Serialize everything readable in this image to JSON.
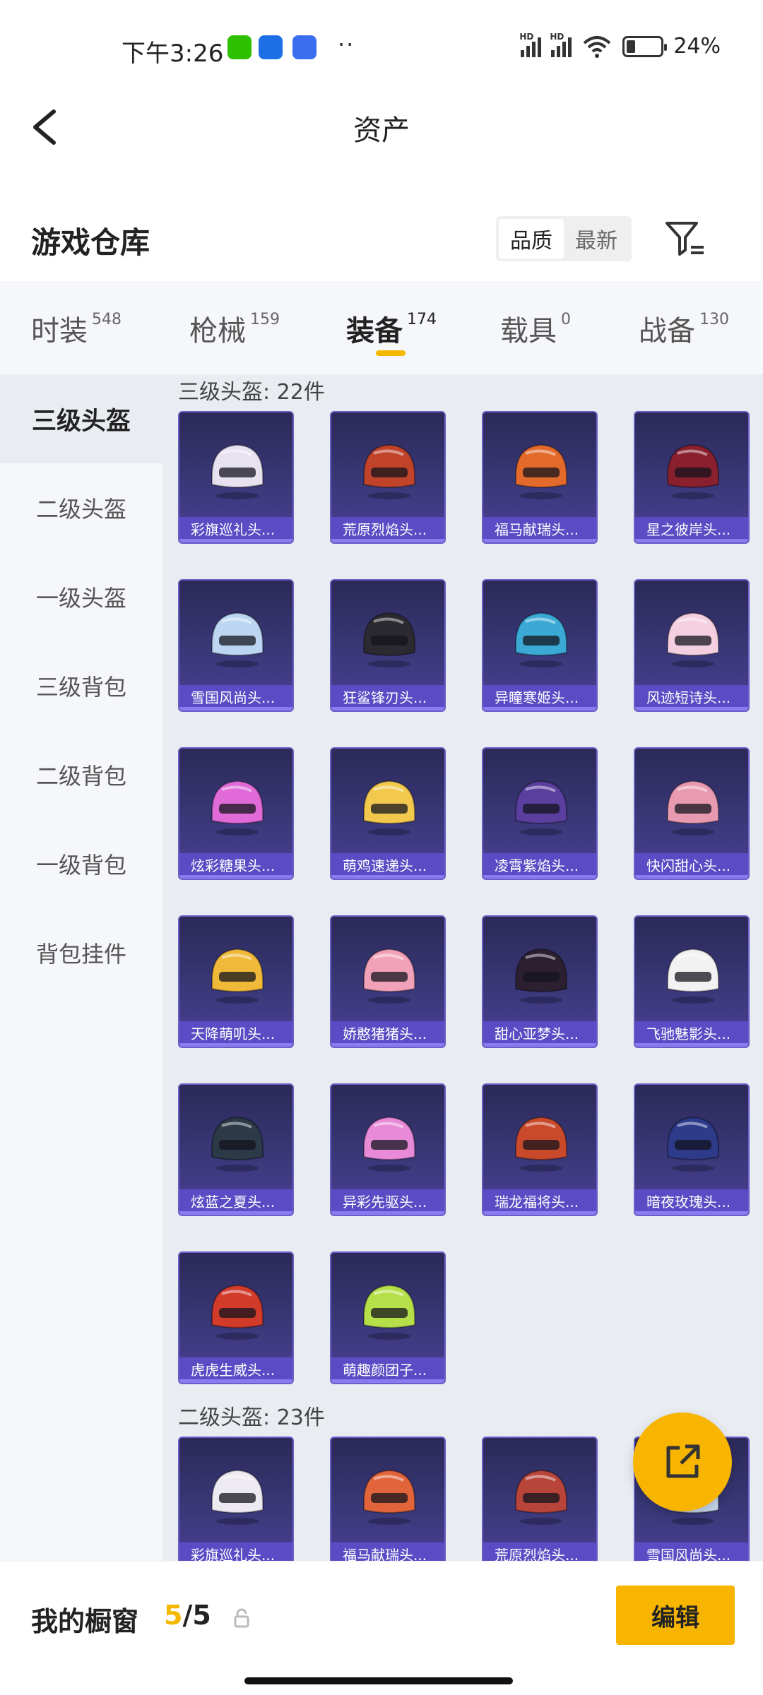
{
  "status": {
    "time": "下午3:26",
    "dots": "··",
    "hd": "HD",
    "battery_level": 0.24,
    "battery_text": "24%",
    "app_colors": [
      "#2dc100",
      "#1e6fe6",
      "#3a6df0"
    ]
  },
  "nav": {
    "title": "资产"
  },
  "warehouse": {
    "title": "游戏仓库",
    "sort_options": [
      "品质",
      "最新"
    ]
  },
  "tabs": [
    {
      "label": "时装",
      "count": "548"
    },
    {
      "label": "枪械",
      "count": "159"
    },
    {
      "label": "装备",
      "count": "174"
    },
    {
      "label": "载具",
      "count": "0"
    },
    {
      "label": "战备",
      "count": "130"
    }
  ],
  "sidebar": {
    "items": [
      {
        "label": "三级头盔"
      },
      {
        "label": "二级头盔"
      },
      {
        "label": "一级头盔"
      },
      {
        "label": "三级背包"
      },
      {
        "label": "二级背包"
      },
      {
        "label": "一级背包"
      },
      {
        "label": "背包挂件"
      }
    ]
  },
  "sections": [
    {
      "title": "三级头盔: 22件",
      "items": [
        {
          "name": "彩旗巡礼头...",
          "color": "#e8e2f0"
        },
        {
          "name": "荒原烈焰头...",
          "color": "#c0432a"
        },
        {
          "name": "福马献瑞头...",
          "color": "#e36a2a"
        },
        {
          "name": "星之彼岸头...",
          "color": "#8a1f2e"
        },
        {
          "name": "雪国风尚头...",
          "color": "#bcd6f2"
        },
        {
          "name": "狂鲨锋刃头...",
          "color": "#2a2a30"
        },
        {
          "name": "异瞳寒姬头...",
          "color": "#3aa9d6"
        },
        {
          "name": "风迹短诗头...",
          "color": "#f4cfe0"
        },
        {
          "name": "炫彩糖果头...",
          "color": "#e06ad8"
        },
        {
          "name": "萌鸡速递头...",
          "color": "#f2c94c"
        },
        {
          "name": "凌霄紫焰头...",
          "color": "#5a3f9e"
        },
        {
          "name": "快闪甜心头...",
          "color": "#e89ab0"
        },
        {
          "name": "天降萌叽头...",
          "color": "#f0b93a"
        },
        {
          "name": "娇憨猪猪头...",
          "color": "#f2a2b8"
        },
        {
          "name": "甜心亚梦头...",
          "color": "#2c2030"
        },
        {
          "name": "飞驰魅影头...",
          "color": "#f2f2f2"
        },
        {
          "name": "炫蓝之夏头...",
          "color": "#2c3a48"
        },
        {
          "name": "异彩先驱头...",
          "color": "#e88ad8"
        },
        {
          "name": "瑞龙福将头...",
          "color": "#c94a2a"
        },
        {
          "name": "暗夜玫瑰头...",
          "color": "#2e3a8a"
        },
        {
          "name": "虎虎生威头...",
          "color": "#d23a2a"
        },
        {
          "name": "萌趣颜团子...",
          "color": "#b6e04a"
        }
      ]
    },
    {
      "title": "二级头盔: 23件",
      "items": [
        {
          "name": "彩旗巡礼头...",
          "color": "#eeeaf2"
        },
        {
          "name": "福马献瑞头...",
          "color": "#e2643a"
        },
        {
          "name": "荒原烈焰头...",
          "color": "#b8443a"
        },
        {
          "name": "雪国风尚头...",
          "color": "#c8d8ee"
        }
      ]
    }
  ],
  "bottom": {
    "my_window_label": "我的橱窗",
    "current": "5",
    "separator_total": "/5",
    "edit_label": "编辑"
  }
}
